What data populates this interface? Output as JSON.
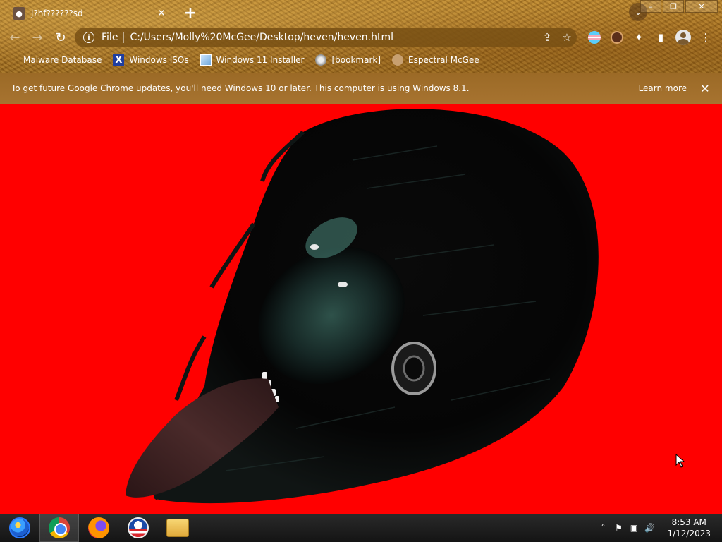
{
  "tab": {
    "title": "j?hf??????sd",
    "close_label": "✕",
    "new_tab_label": "+"
  },
  "tab_search_label": "⌄",
  "window_controls": {
    "minimize": "–",
    "restore": "❐",
    "close": "✕"
  },
  "toolbar": {
    "back": "←",
    "forward": "→",
    "reload": "↻",
    "scheme_label": "File",
    "url": "C:/Users/Molly%20McGee/Desktop/heven/heven.html",
    "share": "⇪",
    "star": "☆",
    "extensions": "✦",
    "sidepanel": "▮",
    "menu": "⋮"
  },
  "bookmarks": [
    {
      "label": "Malware Database",
      "icon": "plain-icon"
    },
    {
      "label": "Windows ISOs",
      "icon": "x-icon"
    },
    {
      "label": "Windows 11 Installer",
      "icon": "installer-icon"
    },
    {
      "label": "[bookmark]",
      "icon": "disc-icon"
    },
    {
      "label": "Espectral McGee",
      "icon": "face-icon"
    }
  ],
  "infobar": {
    "text": "To get future Google Chrome updates, you'll need Windows 10 or later. This computer is using Windows 8.1.",
    "learn_more": "Learn more",
    "close": "✕"
  },
  "page": {
    "background": "#ff0000",
    "artwork": "dark-creature-illustration"
  },
  "taskbar": {
    "apps": [
      "start-orb",
      "chrome",
      "firefox",
      "obama-logo",
      "file-explorer"
    ],
    "tray_chevron": "˄",
    "flag": "⚑",
    "network": "▣",
    "volume": "🔊",
    "time": "8:53 AM",
    "date": "1/12/2023"
  }
}
